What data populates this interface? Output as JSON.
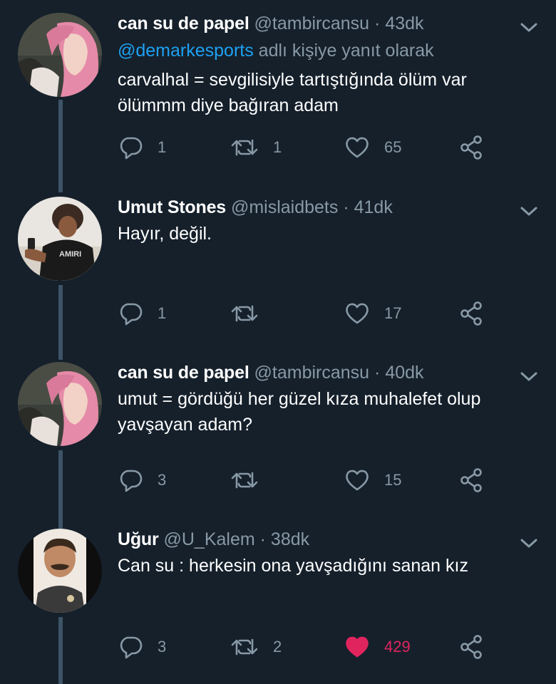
{
  "colors": {
    "background": "#15202b",
    "secondary_text": "#8899a6",
    "link": "#1da1f2",
    "thread_line": "#3d5466",
    "liked": "#e0245e"
  },
  "tweets": [
    {
      "name": "can su de papel",
      "handle": "@tambircansu",
      "dot": "·",
      "time": "43dk",
      "reply_mention": "@demarkesports",
      "reply_suffix": " adlı kişiye yanıt olarak",
      "text_lines": [
        "carvalhal = sevgilisiyle tartıştığında ölüm var",
        "ölümmm diye bağıran adam"
      ],
      "replies": "1",
      "retweets": "1",
      "likes": "65",
      "liked": false
    },
    {
      "name": "Umut Stones",
      "handle": "@mislaidbets",
      "dot": "·",
      "time": "41dk",
      "text_lines": [
        "Hayır, değil."
      ],
      "replies": "1",
      "retweets": "",
      "likes": "17",
      "liked": false
    },
    {
      "name": "can su de papel",
      "handle": "@tambircansu",
      "dot": "·",
      "time": "40dk",
      "text_lines": [
        "umut = gördüğü her güzel kıza muhalefet olup",
        "yavşayan adam?"
      ],
      "replies": "3",
      "retweets": "",
      "likes": "15",
      "liked": false
    },
    {
      "name": "Uğur",
      "handle": "@U_Kalem",
      "dot": "·",
      "time": "38dk",
      "text_lines": [
        "Can su : herkesin ona yavşadığını sanan kız"
      ],
      "replies": "3",
      "retweets": "2",
      "likes": "429",
      "liked": true
    }
  ],
  "icons": {
    "reply": "reply-icon",
    "retweet": "retweet-icon",
    "like": "heart-icon",
    "share": "share-icon",
    "menu": "chevron-down-icon"
  }
}
